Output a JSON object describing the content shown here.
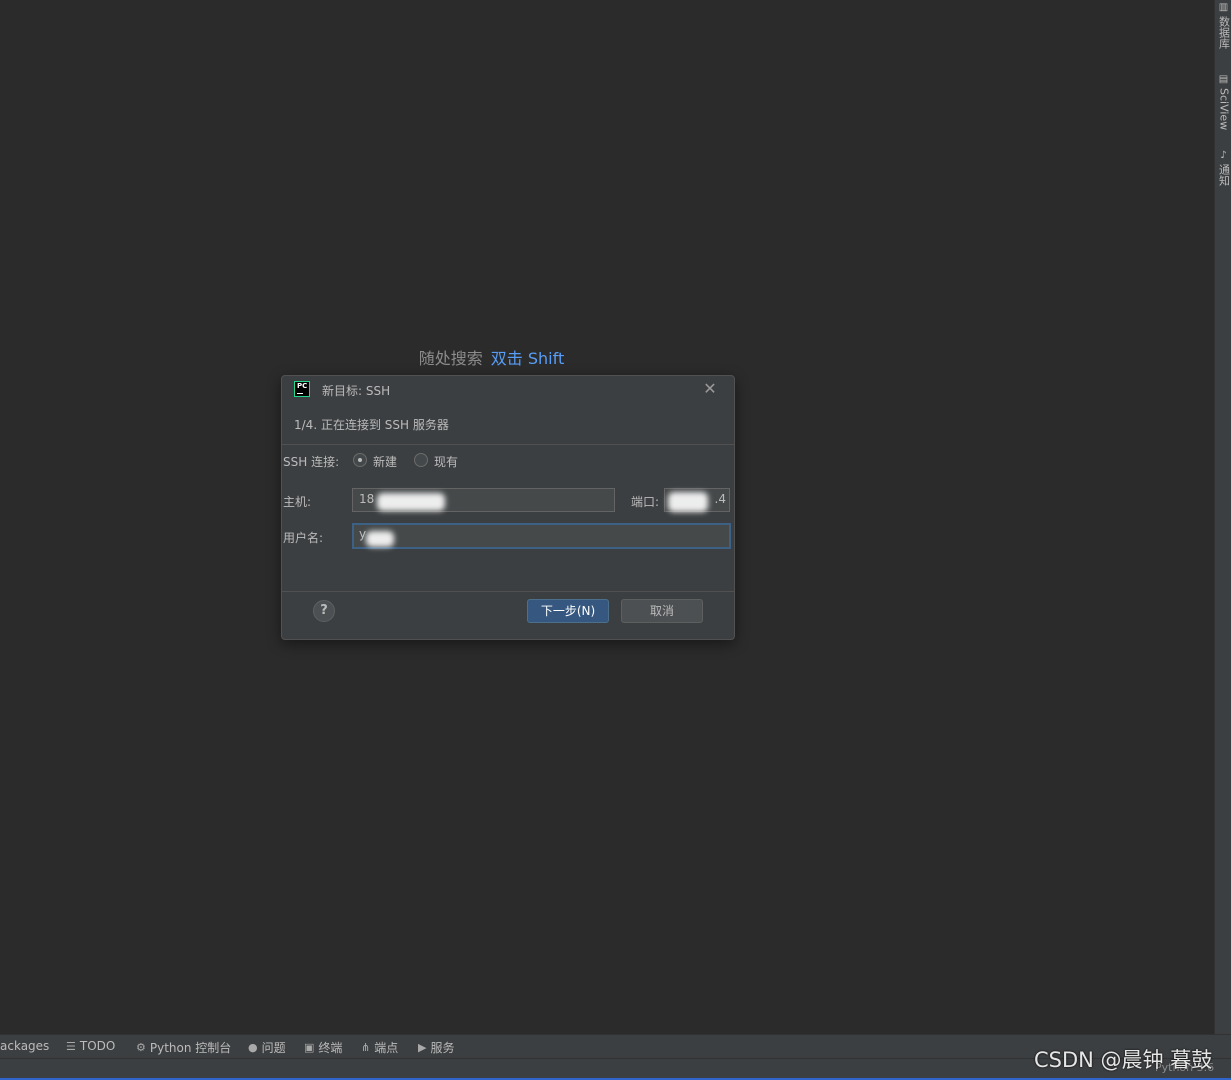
{
  "editor": {
    "search_hint": "随处搜索",
    "search_shortcut": "双击 Shift"
  },
  "right_strip": {
    "items": [
      {
        "label": "数据库",
        "icon": "database-icon"
      },
      {
        "label": "SciView",
        "icon": "sciview-icon"
      },
      {
        "label": "通知",
        "icon": "bell-icon"
      }
    ]
  },
  "dialog": {
    "title": "新目标: SSH",
    "step": "1/4. 正在连接到 SSH 服务器",
    "ssh_label": "SSH 连接:",
    "radio_new": "新建",
    "radio_existing": "现有",
    "selected": "新建",
    "host_label": "主机:",
    "host_value": "18",
    "port_label": "端口:",
    "port_value": ".4",
    "user_label": "用户名:",
    "user_value": "y",
    "next_button": "下一步(N)",
    "cancel_button": "取消",
    "help": "?"
  },
  "bottom_bar": {
    "items": [
      {
        "label": "ackages",
        "icon": ""
      },
      {
        "label": "TODO",
        "icon": "list-icon"
      },
      {
        "label": "Python 控制台",
        "icon": "python-icon"
      },
      {
        "label": "问题",
        "icon": "info-icon"
      },
      {
        "label": "终端",
        "icon": "terminal-icon"
      },
      {
        "label": "端点",
        "icon": "endpoints-icon"
      },
      {
        "label": "服务",
        "icon": "services-icon"
      }
    ]
  },
  "status_bar": {
    "interpreter": "Python 3.6"
  },
  "watermark": "CSDN @晨钟 暮鼓"
}
